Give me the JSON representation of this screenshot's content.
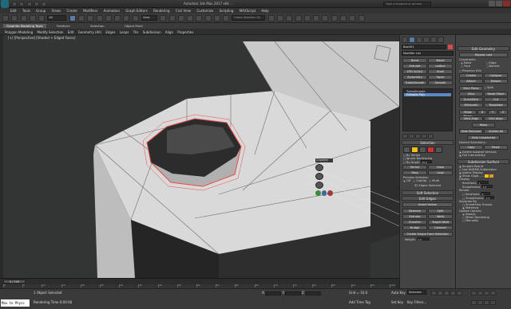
{
  "titlebar": {
    "title": "Autodesk 3ds Max 2017 x64  ...",
    "search_placeholder": "Type a keyword or phrase"
  },
  "menu": [
    "Edit",
    "Tools",
    "Group",
    "Views",
    "Create",
    "Modifiers",
    "Animation",
    "Graph Editors",
    "Rendering",
    "Civil View",
    "Customize",
    "Scripting",
    "MAXScript",
    "Help"
  ],
  "toolbar": {
    "selection_filter": "All",
    "view_dropdown": "View",
    "create_selection_set": "Create Selection Se"
  },
  "ribbon": {
    "tabs": [
      "Graphite Modeling Tools",
      "Freeform",
      "Selection",
      "Object Paint"
    ],
    "subtabs": [
      "Polygon Modeling",
      "Modify Selection",
      "Edit",
      "Geometry (All)",
      "Edges",
      "Loops",
      "Tris",
      "Subdivision",
      "Align",
      "Properties"
    ]
  },
  "viewport": {
    "label": "[+] [Perspective] [Shaded + Edged Faces]",
    "caddy": {
      "title": "Chamfer",
      "value": "1.0",
      "segments": "1"
    }
  },
  "command_panel": {
    "object_name": "Box001",
    "modifier_list": "Modifier List",
    "buttons": [
      "Bend",
      "Bevel",
      "Extrude",
      "Lattice",
      "FFD 3x3x3",
      "Shell",
      "Symmetry",
      "Taper",
      "TurboSmooth",
      "Smooth"
    ],
    "stack": [
      "TurboSmooth",
      "Editable Poly"
    ],
    "selection_title": "Selection",
    "by_vertex": "By Vertex",
    "ignore_backfacing": "Ignore Backfacing",
    "by_angle": "By Angle:",
    "by_angle_value": "45.0",
    "shrink": "Shrink",
    "grow": "Grow",
    "ring": "Ring",
    "loop": "Loop",
    "preview_selection": "Preview Selection",
    "preview_options": [
      "Off",
      "SubObj",
      "Multi"
    ],
    "status": "32 Edges Selected",
    "soft_selection": "Soft Selection",
    "edit_edges": "Edit Edges",
    "insert_vertex": "Insert Vertex",
    "edge_buttons": [
      "Remove",
      "Split",
      "Extrude",
      "Weld",
      "Chamfer",
      "Target Weld",
      "Bridge",
      "Connect"
    ],
    "create_shape": "Create Shape From Selection",
    "weight_label": "Weight:",
    "weight_value": "1.0"
  },
  "edit_geometry": {
    "title": "Edit Geometry",
    "repeat_last": "Repeat Last",
    "constraints": "Constraints",
    "constraint_options": [
      "None",
      "Edge",
      "Face",
      "Normal"
    ],
    "preserve_uvs": "Preserve UVs",
    "buttons_a": [
      "Create",
      "Collapse",
      "Attach",
      "Detach"
    ],
    "slice_plane": "Slice Plane",
    "split": "Split",
    "slice": "Slice",
    "reset_plane": "Reset Plane",
    "quickslice": "QuickSlice",
    "cut": "Cut",
    "msmooth": "MSmooth",
    "tessellate": "Tessellate",
    "make_planar": "Make Planar",
    "xyz": [
      "X",
      "Y",
      "Z"
    ],
    "view_align": "View Align",
    "grid_align": "Grid Align",
    "relax": "Relax",
    "hide_selected": "Hide Selected",
    "unhide_all": "Unhide All",
    "hide_unselected": "Hide Unselected",
    "named_selections": "Named Selections:",
    "copy": "Copy",
    "paste": "Paste",
    "delete_isolated": "Delete Isolated Vertices",
    "full_interactivity": "Full Interactivity",
    "subdivision_surface": "Subdivision Surface",
    "smooth_result": "Smooth Result",
    "use_nurms": "Use NURMS Subdivision",
    "isoline_display": "Isoline Display",
    "show_cage": "Show Cage......",
    "display": "Display",
    "iterations_label": "Iterations:",
    "iterations": "1",
    "smoothness_label": "Smoothness:",
    "smoothness": "1.0",
    "render": "Render",
    "render_iterations": "0",
    "render_smoothness": "1.0",
    "separate_by": "Separate By",
    "smoothing_groups": "Smoothing Groups",
    "materials": "Materials",
    "update_options": "Update Options",
    "update_choices": [
      "Always",
      "When Rendering",
      "Manually"
    ]
  },
  "timeline": {
    "frame_readout": "0 / 100",
    "ticks": [
      "0",
      "5",
      "10",
      "15",
      "20",
      "25",
      "30",
      "35",
      "40",
      "45",
      "50",
      "55",
      "60",
      "65",
      "70",
      "75",
      "80",
      "85",
      "90",
      "95",
      "100"
    ]
  },
  "status": {
    "maxscript": "Max to Physc",
    "objects_selected": "1 Object Selected",
    "render_time": "Rendering Time  0:00:00",
    "x_label": "X:",
    "y_label": "Y:",
    "z_label": "Z:",
    "grid": "Grid = 10.0",
    "add_time_tag": "Add Time Tag",
    "auto_key": "Auto Key",
    "selected": "Selected",
    "set_key": "Set Key",
    "key_filters": "Key Filters..."
  },
  "colors": {
    "selected_edge": "#e84a4a",
    "mesh_light": "#d8d8d8",
    "mesh_dark": "#262626",
    "accent": "#f2c218"
  }
}
